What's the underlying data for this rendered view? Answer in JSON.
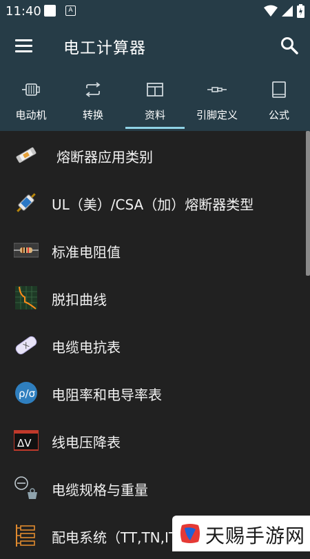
{
  "status_bar": {
    "time": "11:40",
    "a_icon": "A"
  },
  "app_bar": {
    "title": "电工计算器"
  },
  "tabs": [
    {
      "label": "电动机",
      "icon": "motor-icon"
    },
    {
      "label": "转换",
      "icon": "convert-icon"
    },
    {
      "label": "资料",
      "icon": "table-icon",
      "selected": true
    },
    {
      "label": "引脚定义",
      "icon": "connector-icon"
    },
    {
      "label": "公式",
      "icon": "book-icon"
    }
  ],
  "list": {
    "items": [
      {
        "label": "熔断器应用类别",
        "icon": "fuse-icon"
      },
      {
        "label": "UL（美）/CSA（加）熔断器类型",
        "icon": "fuse-angled-icon"
      },
      {
        "label": "标准电阻值",
        "icon": "resistor-icon"
      },
      {
        "label": "脱扣曲线",
        "icon": "trip-curve-icon"
      },
      {
        "label": "电缆电抗表",
        "icon": "cable-reactance-icon"
      },
      {
        "label": "电阻率和电导率表",
        "icon": "rho-sigma-icon"
      },
      {
        "label": "线电压降表",
        "icon": "delta-v-icon"
      },
      {
        "label": "电缆规格与重量",
        "icon": "cable-weight-icon"
      },
      {
        "label": "配电系统（TT,TN,IT）",
        "icon": "distribution-icon"
      }
    ]
  },
  "watermark": {
    "text": "天赐手游网"
  },
  "colors": {
    "app_bar": "#263C47",
    "background": "#212121",
    "indicator": "#8FD3E6"
  }
}
